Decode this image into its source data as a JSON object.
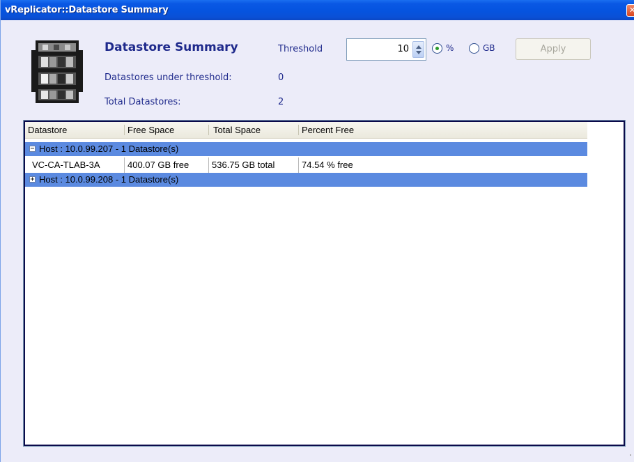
{
  "window": {
    "title": "vReplicator::Datastore Summary",
    "close_label": "x"
  },
  "header": {
    "title": "Datastore Summary",
    "threshold_label": "Threshold",
    "threshold_value": "10",
    "unit_options": [
      {
        "label": "%",
        "selected": true
      },
      {
        "label": "GB",
        "selected": false
      }
    ],
    "apply_label": "Apply",
    "under_threshold_label": "Datastores under threshold:",
    "under_threshold_value": "0",
    "total_label": "Total Datastores:",
    "total_value": "2"
  },
  "list": {
    "columns": [
      "Datastore",
      "Free Space",
      "Total Space",
      "Percent Free"
    ],
    "groups": [
      {
        "label": "Host : 10.0.99.207 - 1 Datastore(s)",
        "expanded": true,
        "toggle": "−",
        "rows": [
          {
            "datastore": "VC-CA-TLAB-3A",
            "free": "400.07 GB free",
            "total": "536.75 GB total",
            "percent": "74.54 % free"
          }
        ]
      },
      {
        "label": "Host : 10.0.99.208 - 1 Datastore(s)",
        "expanded": false,
        "toggle": "+",
        "rows": []
      }
    ]
  },
  "colors": {
    "titlebar": "#0554e0",
    "group_row": "#5b8ae0",
    "label_text": "#1f2a8c",
    "window_bg": "#ECECF9",
    "radio_dot": "#2b9a2b"
  },
  "icons": [
    "database-icon",
    "spinner-up-icon",
    "spinner-down-icon",
    "close-icon",
    "collapse-icon",
    "expand-icon",
    "resize-grip-icon"
  ]
}
